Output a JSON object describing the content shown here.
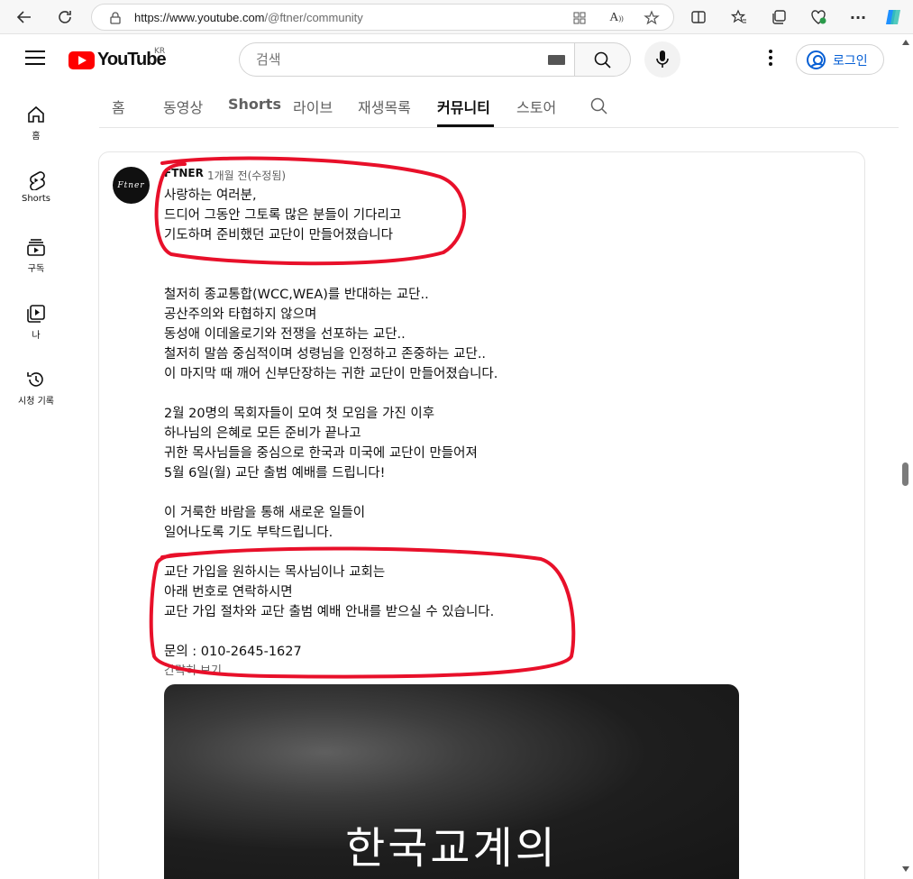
{
  "browser": {
    "url_host": "https://www.youtube.com",
    "url_path": "/@ftner/community"
  },
  "header": {
    "logo_text": "YouTube",
    "region": "KR",
    "search_placeholder": "검색",
    "login_label": "로그인"
  },
  "guide": {
    "items": [
      {
        "label": "홈",
        "icon": "home-icon"
      },
      {
        "label": "Shorts",
        "icon": "shorts-icon"
      },
      {
        "label": "구독",
        "icon": "subscriptions-icon"
      },
      {
        "label": "나",
        "icon": "you-icon"
      },
      {
        "label": "시청 기록",
        "icon": "history-icon"
      }
    ]
  },
  "tabs": [
    {
      "label": "홈"
    },
    {
      "label": "동영상"
    },
    {
      "label": "Shorts"
    },
    {
      "label": "라이브"
    },
    {
      "label": "재생목록"
    },
    {
      "label": "커뮤니티"
    },
    {
      "label": "스토어"
    }
  ],
  "active_tab": "커뮤니티",
  "post": {
    "author": "FTNER",
    "avatar_text": "Ftner",
    "time": "1개월 전(수정됨)",
    "body": "사랑하는 여러분,\n드디어 그동안 그토록 많은 분들이 기다리고\n기도하며 준비했던 교단이 만들어졌습니다\n\n\n철저히 종교통합(WCC,WEA)를 반대하는 교단..\n공산주의와 타협하지 않으며\n동성애 이데올로기와 전쟁을 선포하는 교단..\n철저히 말씀 중심적이며 성령님을 인정하고 존중하는 교단..\n이 마지막 때 깨어 신부단장하는 귀한 교단이 만들어졌습니다.\n\n2월 20명의 목회자들이 모여 첫 모임을 가진 이후\n하나님의 은혜로 모든 준비가 끝나고\n귀한 목사님들을 중심으로 한국과 미국에 교단이 만들어져\n5월 6일(월) 교단 출범 예배를 드립니다!\n\n이 거룩한 바람을 통해 새로운 일들이\n일어나도록 기도 부탁드립니다.\n\n교단 가입을 원하시는 목사님이나 교회는\n아래 번호로 연락하시면\n교단 가입 절차와 교단 출범 예배 안내를 받으실 수 있습니다.\n\n문의 : 010-2645-1627",
    "show_less": "간략히 보기",
    "image_caption": "한국교계의"
  },
  "colors": {
    "annotation": "#e8102a",
    "link_blue": "#065fd4",
    "brand_red": "#ff0000"
  }
}
